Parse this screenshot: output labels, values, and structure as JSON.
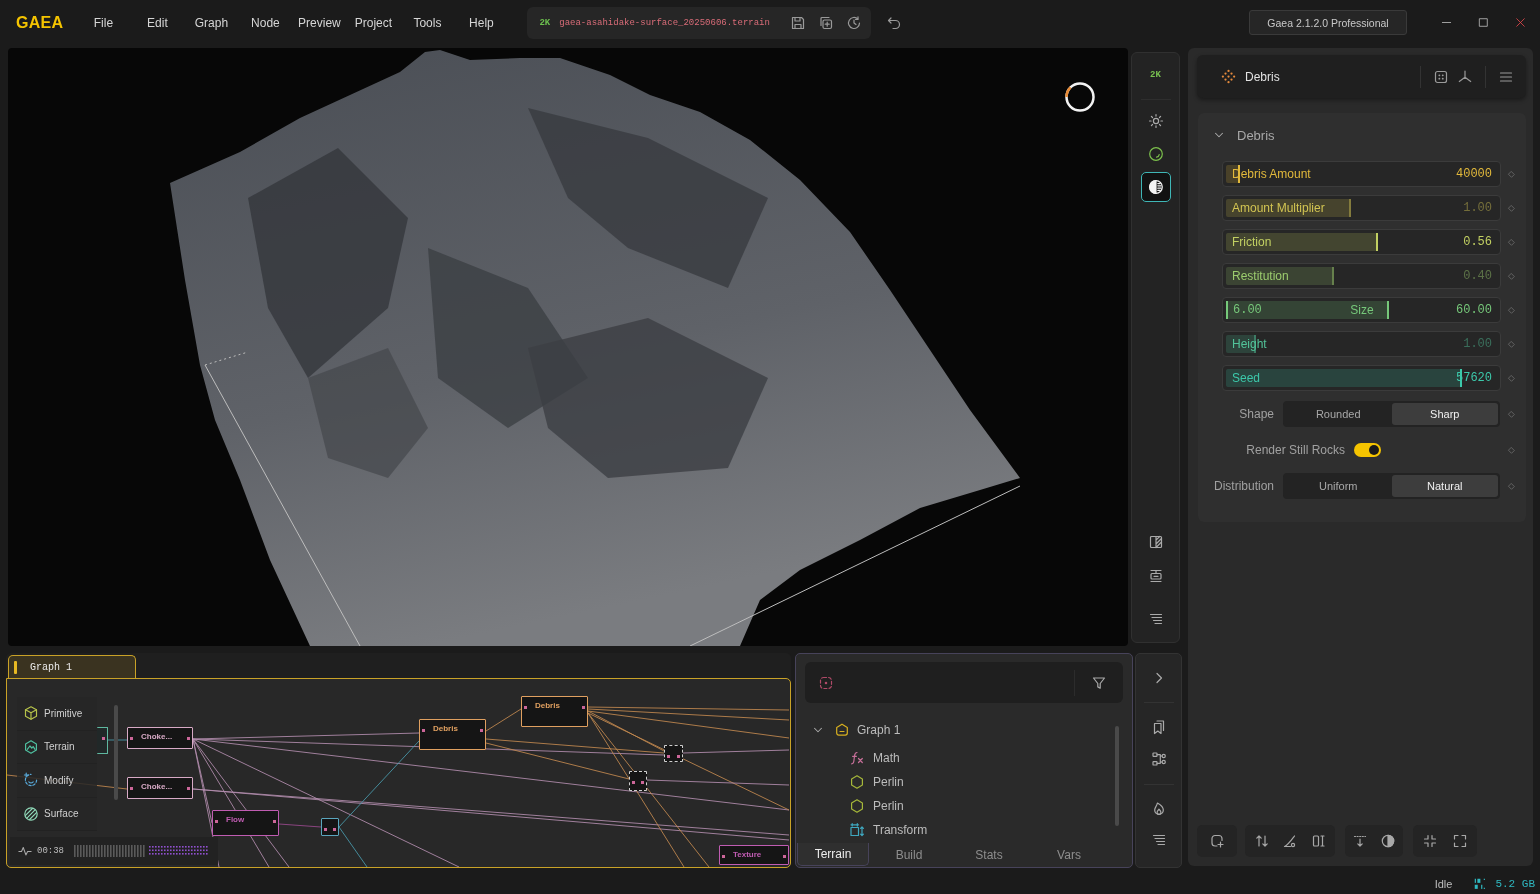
{
  "window": {
    "logo": "GAEA",
    "menu": [
      "File",
      "Edit",
      "Graph",
      "Node",
      "Preview",
      "Project",
      "Tools",
      "Help"
    ],
    "file": {
      "resolution": "2K",
      "name": "gaea-asahidake-surface_20250606.terrain"
    },
    "version": "Gaea 2.1.2.0 Professional"
  },
  "viewport": {
    "resolution": "2K",
    "tools": [
      {
        "selected": false
      },
      {
        "selected": false
      },
      {
        "selected": true
      }
    ]
  },
  "graph": {
    "tab": {
      "label": "Graph 1",
      "selected": true
    },
    "palette": [
      {
        "label": "Primitive"
      },
      {
        "label": "Terrain"
      },
      {
        "label": "Modify"
      },
      {
        "label": "Surface"
      }
    ],
    "nodes": [
      {
        "kind": "faded",
        "color": "#5fb8a0"
      },
      {
        "kind": "node",
        "label": "Choke...",
        "color": "#d8aac6"
      },
      {
        "kind": "node",
        "label": "Choke...",
        "color": "#d8aac6"
      },
      {
        "kind": "node",
        "label": "Flow",
        "color": "#c05cb2"
      },
      {
        "kind": "reroute",
        "color": "#5aa6be"
      },
      {
        "kind": "node",
        "label": "Debris",
        "color": "#e0a060"
      },
      {
        "kind": "node",
        "label": "Debris",
        "color": "#e0a060"
      },
      {
        "kind": "dotted",
        "color": "#cfcfcf"
      },
      {
        "kind": "dotted",
        "color": "#cfcfcf"
      },
      {
        "kind": "node",
        "label": "Texture",
        "color": "#c05cb2"
      }
    ],
    "timer": "00:38"
  },
  "outline": {
    "tree": [
      {
        "label": "Graph 1",
        "expanded": true,
        "children": [
          {
            "label": "Math",
            "kind": "math"
          },
          {
            "label": "Perlin",
            "kind": "primitive"
          },
          {
            "label": "Perlin",
            "kind": "primitive"
          },
          {
            "label": "Transform",
            "kind": "transform"
          }
        ]
      }
    ],
    "tabs": [
      {
        "label": "Terrain",
        "selected": true
      },
      {
        "label": "Build",
        "selected": false
      },
      {
        "label": "Stats",
        "selected": false
      },
      {
        "label": "Vars",
        "selected": false
      }
    ]
  },
  "properties": {
    "node": "Debris",
    "section": {
      "title": "Debris",
      "expanded": true
    },
    "rows": [
      {
        "kind": "slider",
        "label": "Debris Amount",
        "value": "40000",
        "level": 0.05,
        "color": "#e2b93b",
        "modified": true
      },
      {
        "kind": "slider",
        "label": "Amount Multiplier",
        "value": "1.00",
        "level": 0.46,
        "color": "#d2c452",
        "modified": false
      },
      {
        "kind": "slider",
        "label": "Friction",
        "value": "0.56",
        "level": 0.56,
        "color": "#c2d062",
        "modified": true
      },
      {
        "kind": "slider",
        "label": "Restitution",
        "value": "0.40",
        "level": 0.4,
        "color": "#9ccc6e",
        "modified": false
      },
      {
        "kind": "range",
        "label": "Size",
        "low": "6.00",
        "value": "60.00",
        "level": 0.6,
        "color": "#76c87a",
        "modified": true
      },
      {
        "kind": "slider",
        "label": "Height",
        "value": "1.00",
        "level": 0.11,
        "color": "#52c49a",
        "modified": false
      },
      {
        "kind": "slider",
        "label": "Seed",
        "value": "57620",
        "level": 0.87,
        "color": "#3cc8aa",
        "modified": true
      },
      {
        "kind": "choice",
        "label": "Shape",
        "options": [
          {
            "label": "Rounded",
            "selected": false
          },
          {
            "label": "Sharp",
            "selected": true
          }
        ]
      },
      {
        "kind": "toggle",
        "label": "Render Still Rocks",
        "on": true
      },
      {
        "kind": "choice",
        "label": "Distribution",
        "options": [
          {
            "label": "Uniform",
            "selected": false
          },
          {
            "label": "Natural",
            "selected": true
          }
        ]
      }
    ]
  },
  "status_bar": {
    "state": "Idle",
    "memory": "5.2 GB"
  }
}
